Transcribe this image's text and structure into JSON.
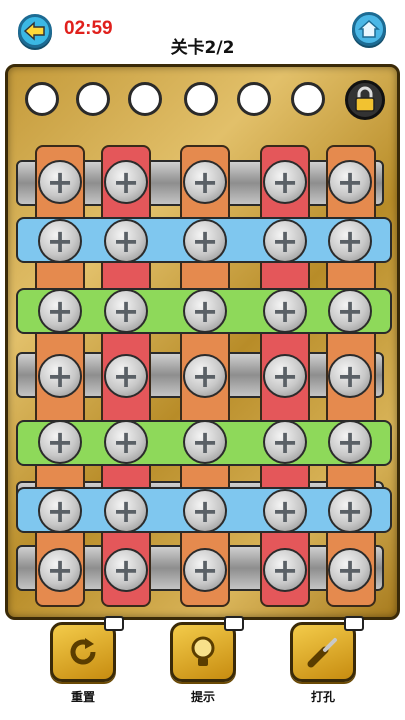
{
  "header": {
    "timer": "02:59",
    "level": "关卡2/2",
    "back_icon": "arrow-left-icon",
    "home_icon": "home-icon"
  },
  "board": {
    "hole_slots": 6,
    "lock_icon": "padlock-icon",
    "colors": {
      "orange": "#e58a4e",
      "red": "#e4575a",
      "blue": "#7fc7ef",
      "green": "#8ed95a",
      "gold": "#c9a24a"
    }
  },
  "tools": [
    {
      "label": "重置",
      "icon": "reset-icon"
    },
    {
      "label": "提示",
      "icon": "lightbulb-icon"
    },
    {
      "label": "打孔",
      "icon": "drill-icon"
    }
  ]
}
